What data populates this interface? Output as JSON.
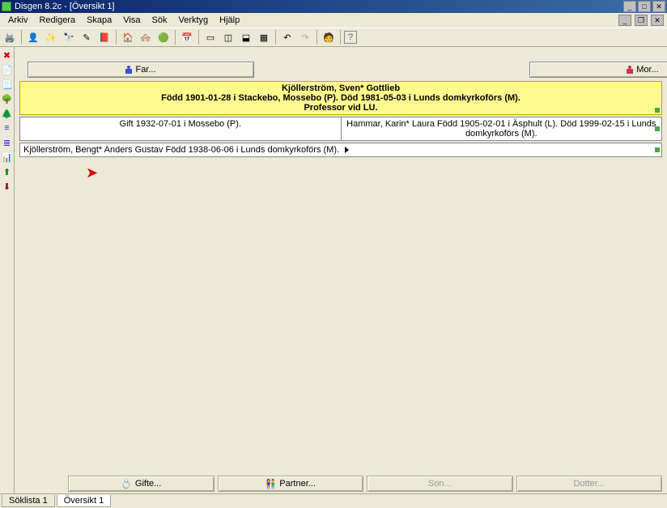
{
  "window": {
    "title": "Disgen 8.2c - [Översikt 1]"
  },
  "menu": {
    "arkiv": "Arkiv",
    "redigera": "Redigera",
    "skapa": "Skapa",
    "visa": "Visa",
    "sok": "Sök",
    "verktyg": "Verktyg",
    "hjalp": "Hjälp"
  },
  "parents": {
    "far_label": "Far...",
    "mor_label": "Mor..."
  },
  "person": {
    "name": "Kjöllerström, Sven* Gottlieb",
    "line2": "Född 1901-01-28 i Stackebo, Mossebo (P). Död 1981-05-03 i Lunds domkyrkoförs (M).",
    "line3": "Professor vid LU."
  },
  "marriage": {
    "text": "Gift 1932-07-01 i Mossebo (P)."
  },
  "spouse": {
    "text": "Hammar, Karin* Laura Född 1905-02-01 i Äsphult (L). Död 1999-02-15 i Lunds domkyrkoförs (M)."
  },
  "child": {
    "text": "Kjöllerström, Bengt* Anders Gustav Född 1938-06-06 i Lunds domkyrkoförs (M)."
  },
  "bottom": {
    "gifte": "Gifte...",
    "partner": "Partner...",
    "son": "Son...",
    "dotter": "Dotter..."
  },
  "tabs": {
    "soklista": "Söklista 1",
    "oversikt": "Översikt 1"
  },
  "icons": {
    "print": "print-icon",
    "person": "person-icon",
    "wand": "wand-icon",
    "binoculars": "binoculars-icon",
    "pen": "pen-icon",
    "book": "book-icon",
    "home": "home-icon",
    "homes": "homes-icon",
    "globe": "globe-icon",
    "calendar": "calendar-icon",
    "win1": "single-pane-icon",
    "win2": "split-vert-icon",
    "win3": "split-horiz-icon",
    "win4": "tile-icon",
    "undo": "undo-icon",
    "redo": "redo-icon",
    "marker": "marker-icon",
    "help": "help-icon"
  }
}
